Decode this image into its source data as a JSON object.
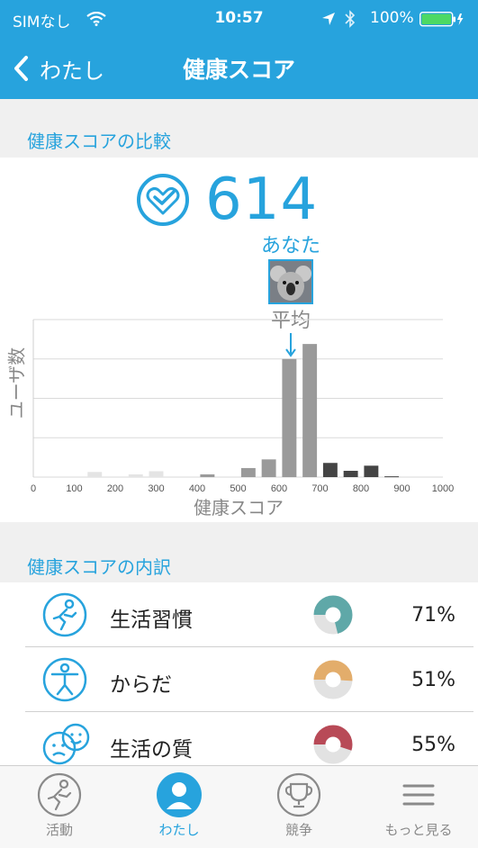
{
  "status_bar": {
    "carrier": "SIMなし",
    "time": "10:57",
    "battery": "100%"
  },
  "nav": {
    "back_label": "わたし",
    "title": "健康スコア"
  },
  "comparison": {
    "heading": "健康スコアの比較",
    "score": "614",
    "you_label": "あなた",
    "average_label": "平均"
  },
  "chart_data": {
    "type": "bar",
    "xlabel": "健康スコア",
    "ylabel": "ユーザ数",
    "xlim": [
      0,
      1000
    ],
    "ylim": [
      0,
      4
    ],
    "grid": "horizontal",
    "x_ticks": [
      "0",
      "100",
      "200",
      "300",
      "400",
      "500",
      "600",
      "700",
      "800",
      "900",
      "1000"
    ],
    "bins": [
      {
        "x": 150,
        "value": 0.13,
        "color": "#e4e4e4"
      },
      {
        "x": 250,
        "value": 0.07,
        "color": "#e4e4e4"
      },
      {
        "x": 300,
        "value": 0.15,
        "color": "#e4e4e4"
      },
      {
        "x": 425,
        "value": 0.07,
        "color": "#9a9a9a"
      },
      {
        "x": 525,
        "value": 0.23,
        "color": "#9a9a9a"
      },
      {
        "x": 575,
        "value": 0.45,
        "color": "#9a9a9a"
      },
      {
        "x": 625,
        "value": 3.0,
        "color": "#9a9a9a"
      },
      {
        "x": 675,
        "value": 3.38,
        "color": "#9a9a9a"
      },
      {
        "x": 725,
        "value": 0.36,
        "color": "#444444"
      },
      {
        "x": 775,
        "value": 0.16,
        "color": "#444444"
      },
      {
        "x": 825,
        "value": 0.29,
        "color": "#444444"
      },
      {
        "x": 875,
        "value": 0.02,
        "color": "#444444"
      }
    ],
    "average_marker": 625,
    "you_marker": 614
  },
  "breakdown": {
    "heading": "健康スコアの内訳",
    "items": [
      {
        "name": "生活習慣",
        "percent": "71%",
        "value": 0.71,
        "color": "#5fa8a8",
        "icon": "lifestyle-icon"
      },
      {
        "name": "からだ",
        "percent": "51%",
        "value": 0.51,
        "color": "#e3ad6b",
        "icon": "body-icon"
      },
      {
        "name": "生活の質",
        "percent": "55%",
        "value": 0.55,
        "color": "#b84a57",
        "icon": "quality-of-life-icon"
      }
    ]
  },
  "tabs": [
    {
      "label": "活動",
      "icon": "activity-icon"
    },
    {
      "label": "わたし",
      "icon": "person-icon",
      "active": true
    },
    {
      "label": "競争",
      "icon": "trophy-icon"
    },
    {
      "label": "もっと見る",
      "icon": "menu-icon"
    }
  ],
  "colors": {
    "accent": "#27a3dd",
    "background": "#f0f0f0"
  }
}
